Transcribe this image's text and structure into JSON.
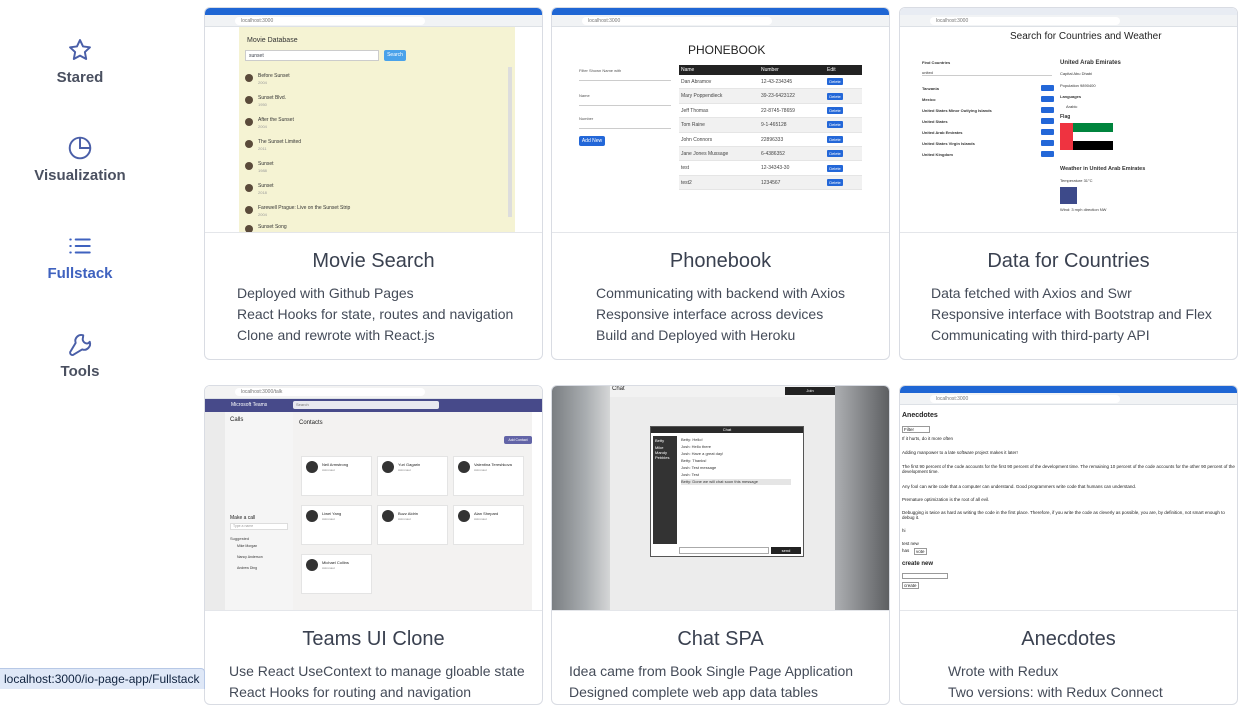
{
  "sidebar": {
    "items": [
      {
        "label": "Stared",
        "icon": "star-icon",
        "active": false
      },
      {
        "label": "Visualization",
        "icon": "pie-chart-icon",
        "active": false
      },
      {
        "label": "Fullstack",
        "icon": "list-icon",
        "active": true
      },
      {
        "label": "Tools",
        "icon": "wrench-icon",
        "active": false
      }
    ]
  },
  "status_bar": {
    "url": "localhost:3000/io-page-app/Fullstack"
  },
  "colors": {
    "accent": "#3f62bf",
    "text": "#3a4150",
    "border": "#d9dce3"
  },
  "cards": [
    {
      "title": "Movie Search",
      "lines": [
        "Deployed with Github Pages",
        "React Hooks for state, routes and navigation",
        "Clone and rewrote with React.js"
      ],
      "thumb": {
        "url": "localhost:3000",
        "heading": "Movie Database",
        "input": "sunset",
        "button": "Search",
        "items": [
          {
            "title": "Before Sunset",
            "year": "2004"
          },
          {
            "title": "Sunset Blvd.",
            "year": "1950"
          },
          {
            "title": "After the Sunset",
            "year": "2004"
          },
          {
            "title": "The Sunset Limited",
            "year": "2011"
          },
          {
            "title": "Sunset",
            "year": "1988"
          },
          {
            "title": "Sunset",
            "year": "2018"
          },
          {
            "title": "Farewell Prague: Live on the Sunset Strip",
            "year": "2004"
          },
          {
            "title": "Sunset Song",
            "year": "2015"
          }
        ]
      }
    },
    {
      "title": "Phonebook",
      "lines": [
        "Communicating with backend with Axios",
        "Responsive interface across devices",
        "Build and Deployed with Heroku"
      ],
      "thumb": {
        "url": "localhost:3000",
        "heading": "PHONEBOOK",
        "filter_label": "Filter Shown Name with",
        "name_label": "Name",
        "number_label": "Number",
        "add_button": "Add New",
        "columns": [
          "Name",
          "Number",
          "Edit"
        ],
        "delete": "Delete",
        "rows": [
          [
            "Dan Abramov",
            "12-43-234345"
          ],
          [
            "Mary Poppendieck",
            "39-23-6423122"
          ],
          [
            "Jeff Thomas",
            "22-8745-78659"
          ],
          [
            "Tom Raine",
            "9-1-465128"
          ],
          [
            "John Connors",
            "22896333"
          ],
          [
            "Jane Jones Mussage",
            "6-4386352"
          ],
          [
            "test",
            "12-34343-30"
          ],
          [
            "test2",
            "1234567"
          ]
        ]
      }
    },
    {
      "title": "Data for Countries",
      "lines": [
        "Data fetched with Axios and Swr",
        "Responsive interface with Bootstrap and Flex",
        "Communicating with third-party API"
      ],
      "thumb": {
        "url": "localhost:3000",
        "heading": "Search for Countries and Weather",
        "find_label": "Find Countries",
        "input": "united",
        "countries": [
          "Tanzania",
          "Mexico",
          "United States Minor Outlying Islands",
          "United States",
          "United Arab Emirates",
          "United States Virgin Islands",
          "United Kingdom"
        ],
        "detail_title": "United Arab Emirates",
        "capital": "Capital Abu Dhabi",
        "population": "Population 9890400",
        "languages_label": "Languages",
        "language": "Arabic",
        "flag_label": "Flag",
        "weather_title": "Weather in United Arab Emirates",
        "temperature": "Temperature 31°C",
        "wind": "Wind: 3 mph direction NW"
      }
    },
    {
      "title": "Teams UI Clone",
      "lines": [
        "Use React UseContext to manage gloable state",
        "React Hooks for routing and navigation"
      ],
      "thumb": {
        "url": "localhost:3000/talk",
        "app": "Microsoft Teams",
        "search": "Search",
        "calls": "Calls",
        "contacts_title": "Contacts",
        "add_contact": "Add Contact",
        "make_call": "Make a call",
        "type_name": "Type a name",
        "suggested": "Suggested",
        "suggested_people": [
          "Mike Morgan",
          "Nancy Anderson",
          "Andrew Ding"
        ],
        "contacts": [
          {
            "name": "Neil Armstrong",
            "role": "Astronaut"
          },
          {
            "name": "Yuri Gagarin",
            "role": "Astronaut"
          },
          {
            "name": "Valentina Tereshkova",
            "role": "Astronaut"
          },
          {
            "name": "Liwei Yang",
            "role": "Astronaut"
          },
          {
            "name": "Buzz Aldrin",
            "role": "Astronaut"
          },
          {
            "name": "Alan Shepard",
            "role": "Astronaut"
          },
          {
            "name": "Michael Collins",
            "role": "Astronaut"
          }
        ]
      }
    },
    {
      "title": "Chat SPA",
      "lines": [
        "Idea came from Book Single Page Application",
        "Designed complete web app data tables"
      ],
      "thumb": {
        "heading": "Chat",
        "join": "Join",
        "window_title": "Chat",
        "users": [
          "Betty",
          "Mike",
          "Mandy",
          "Pebbles"
        ],
        "messages": [
          "Betty: Hello!",
          "Josh: Hello there",
          "Josh: Have a great day!",
          "Betty: Thanks!",
          "Josh: Test message",
          "Josh: Test",
          "Betty: Done we will chat soon this message"
        ],
        "send": "send"
      }
    },
    {
      "title": "Anecdotes",
      "lines": [
        "Wrote with Redux",
        "Two versions: with Redux Connect"
      ],
      "thumb": {
        "url": "localhost:3000",
        "heading": "Anecdotes",
        "filter": "Filter",
        "anecdotes": [
          "If it hurts, do it more often",
          "Adding manpower to a late software project makes it later!",
          "The first 90 percent of the code accounts for the first 90 percent of the development time. The remaining 10 percent of the code accounts for the other 90 percent of the development time.",
          "Any fool can write code that a computer can understand. Good programmers write code that humans can understand.",
          "Premature optimization is the root of all evil.",
          "Debugging is twice as hard as writing the code in the first place. Therefore, if you write the code as cleverly as possible, you are, by definition, not smart enough to debug it.",
          "hi",
          "test new"
        ],
        "has_label": "has",
        "vote": "vote",
        "create_new": "create new",
        "create_button": "create"
      }
    }
  ]
}
